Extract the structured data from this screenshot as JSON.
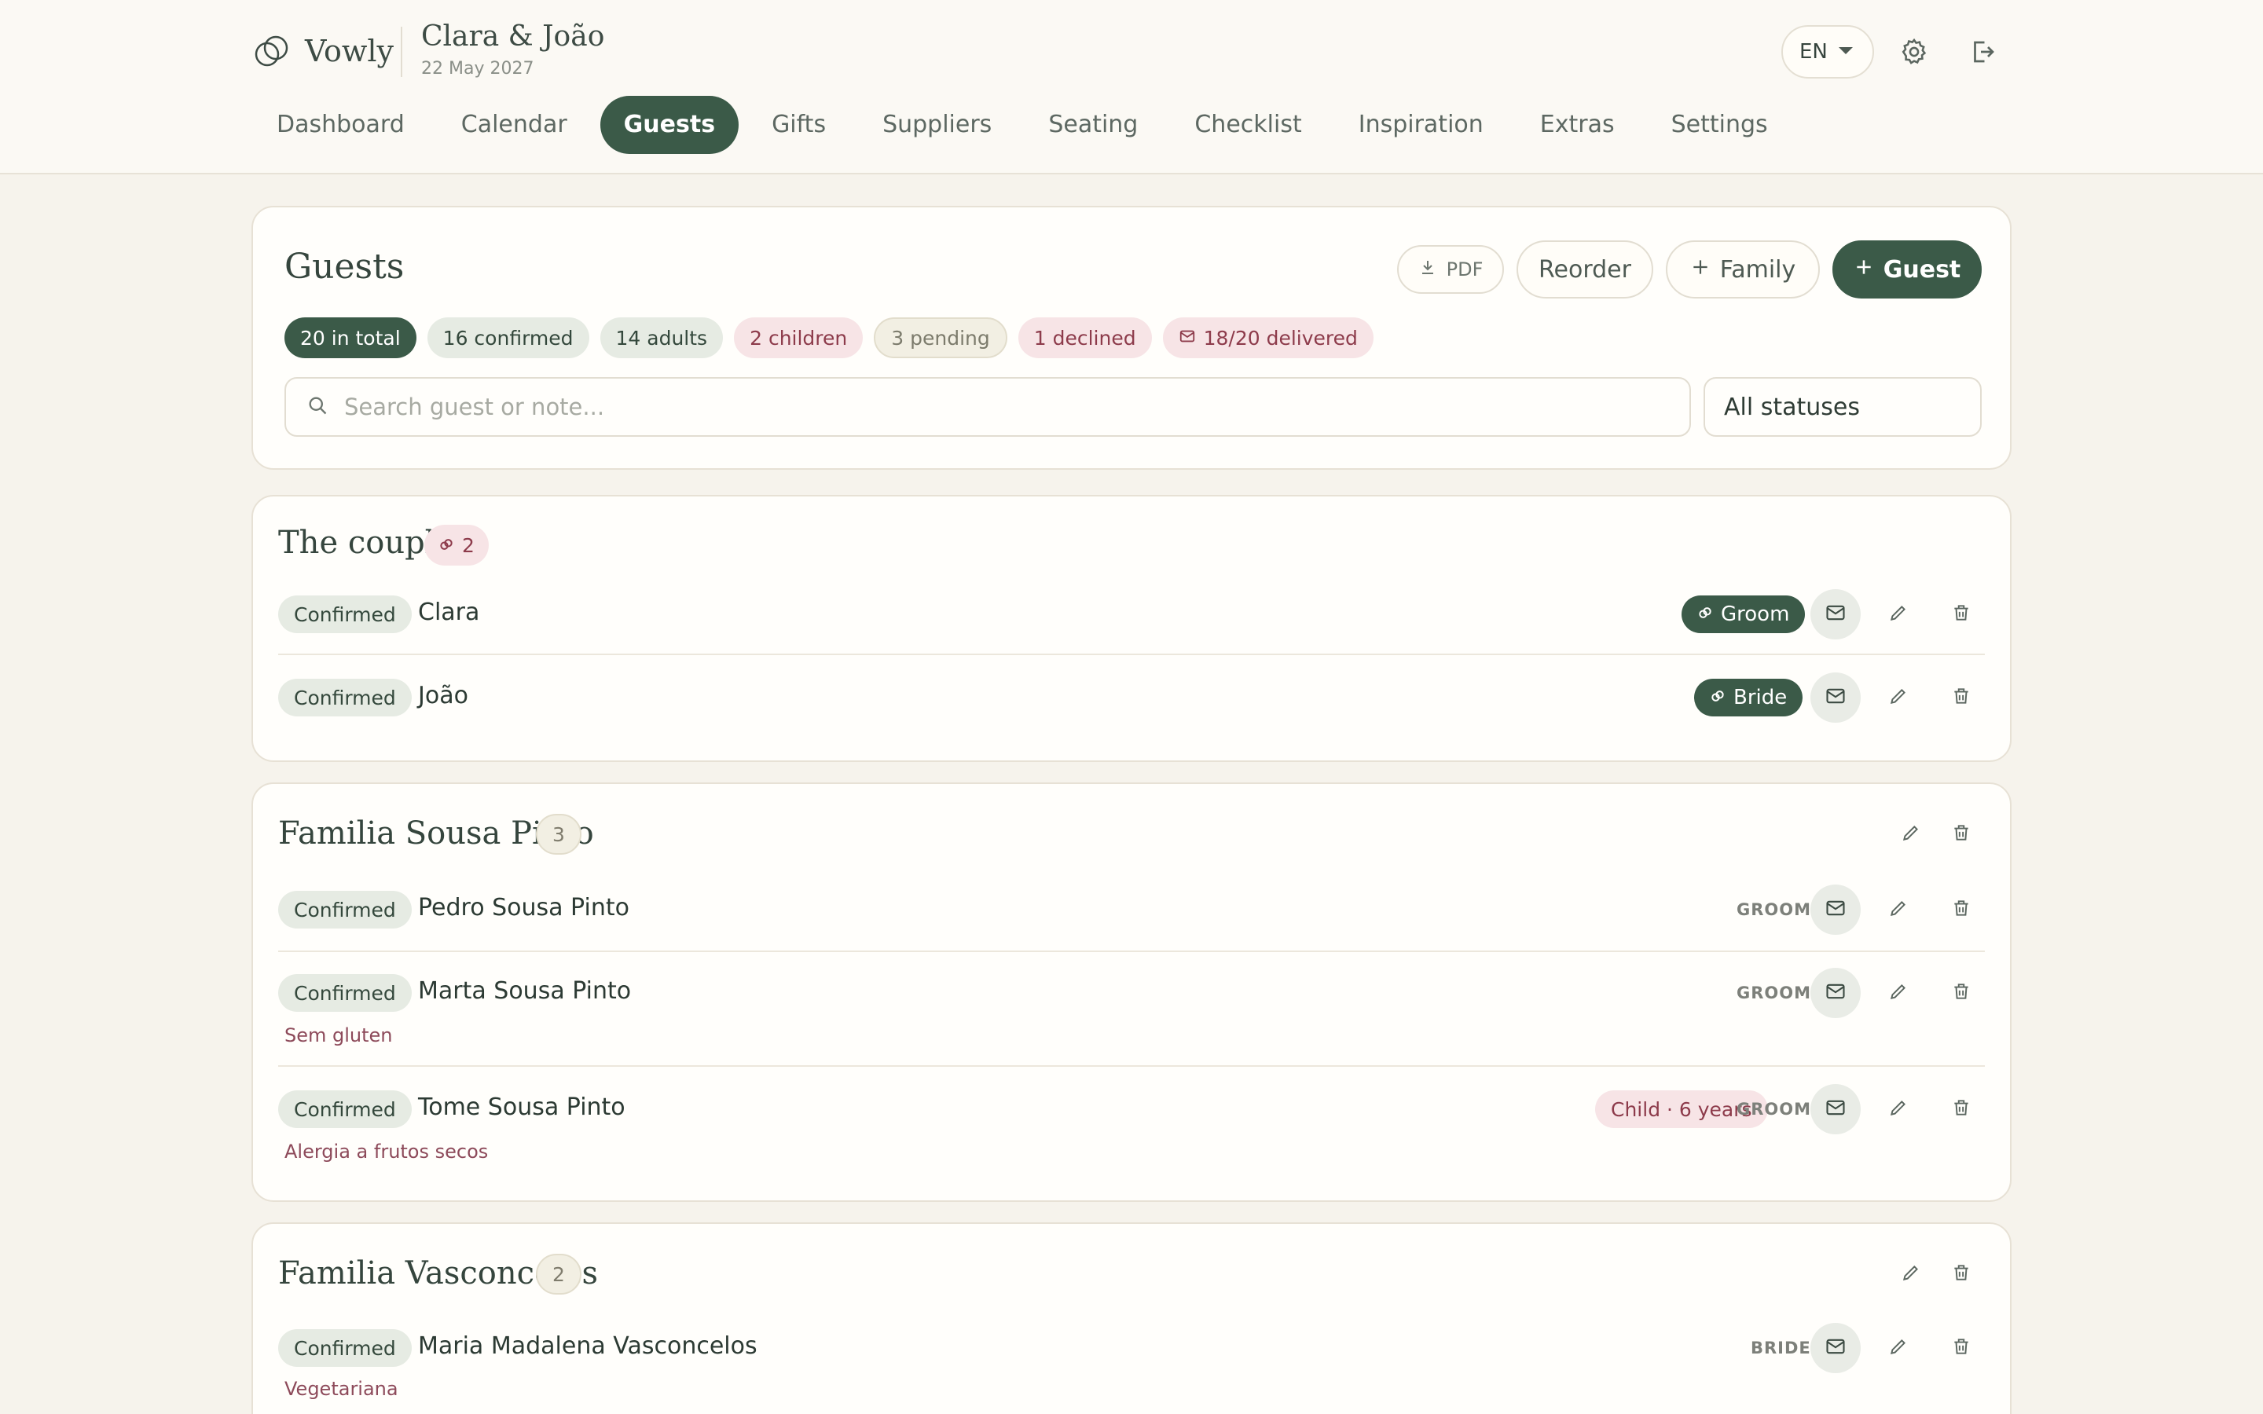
{
  "app": {
    "name": "Vowly"
  },
  "event": {
    "title": "Clara & João",
    "date": "22 May 2027"
  },
  "header": {
    "language": "EN"
  },
  "nav": [
    "Dashboard",
    "Calendar",
    "Guests",
    "Gifts",
    "Suppliers",
    "Seating",
    "Checklist",
    "Inspiration",
    "Extras",
    "Settings"
  ],
  "nav_active": "Guests",
  "guests_panel": {
    "title": "Guests",
    "buttons": {
      "pdf": "PDF",
      "reorder": "Reorder",
      "family": "Family",
      "guest": "Guest"
    },
    "stats": {
      "total": "20 in total",
      "confirmed": "16 confirmed",
      "adults": "14 adults",
      "children": "2 children",
      "pending": "3 pending",
      "declined": "1 declined",
      "delivered": "18/20 delivered"
    },
    "search_placeholder": "Search guest or note...",
    "status_filter": "All statuses"
  },
  "groups": [
    {
      "name": "The couple",
      "count": "2",
      "guests": [
        {
          "status": "Confirmed",
          "name": "Clara",
          "role": "Groom"
        },
        {
          "status": "Confirmed",
          "name": "João",
          "role": "Bride"
        }
      ]
    },
    {
      "name": "Familia Sousa Pinto",
      "count": "3",
      "guests": [
        {
          "status": "Confirmed",
          "name": "Pedro Sousa Pinto",
          "side": "GROOM"
        },
        {
          "status": "Confirmed",
          "name": "Marta Sousa Pinto",
          "side": "GROOM",
          "note": "Sem gluten"
        },
        {
          "status": "Confirmed",
          "name": "Tome Sousa Pinto",
          "side": "GROOM",
          "age": "Child · 6 years",
          "note": "Alergia a frutos secos"
        }
      ]
    },
    {
      "name": "Familia Vasconcelos",
      "count": "2",
      "guests": [
        {
          "status": "Confirmed",
          "name": "Maria Madalena Vasconcelos",
          "side": "BRIDE",
          "note": "Vegetariana"
        }
      ]
    }
  ],
  "colors": {
    "accent": "#3b5a48",
    "background": "#f6f3ec",
    "pink_badge": "#f7e4e6",
    "note_text": "#8d4a5a"
  },
  "icons": [
    "logo-rings-icon",
    "chevron-down-icon",
    "gear-icon",
    "logout-icon",
    "download-icon",
    "plus-icon",
    "search-icon",
    "mail-icon",
    "link-icon",
    "pencil-icon",
    "trash-icon"
  ]
}
